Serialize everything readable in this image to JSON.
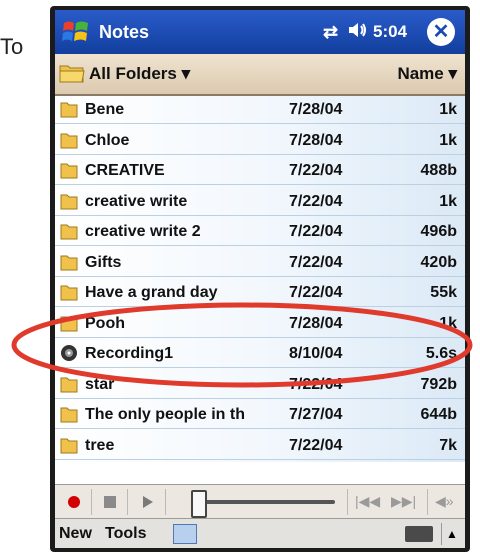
{
  "side_text": "To",
  "titlebar": {
    "app_title": "Notes",
    "clock": "5:04",
    "close_label": "✕",
    "sync_icon": "⇄",
    "volume_icon": "◀€"
  },
  "folderbar": {
    "folder_label": "All Folders ▾",
    "sort_label": "Name ▾"
  },
  "files": [
    {
      "name": "Bene",
      "date": "7/28/04",
      "size": "1k",
      "type": "folder"
    },
    {
      "name": "Chloe",
      "date": "7/28/04",
      "size": "1k",
      "type": "folder"
    },
    {
      "name": "CREATIVE",
      "date": "7/22/04",
      "size": "488b",
      "type": "folder"
    },
    {
      "name": "creative write",
      "date": "7/22/04",
      "size": "1k",
      "type": "folder"
    },
    {
      "name": "creative write 2",
      "date": "7/22/04",
      "size": "496b",
      "type": "folder"
    },
    {
      "name": "Gifts",
      "date": "7/22/04",
      "size": "420b",
      "type": "folder"
    },
    {
      "name": "Have a grand day",
      "date": "7/22/04",
      "size": "55k",
      "type": "folder"
    },
    {
      "name": "Pooh",
      "date": "7/28/04",
      "size": "1k",
      "type": "folder"
    },
    {
      "name": "Recording1",
      "date": "8/10/04",
      "size": "5.6s",
      "type": "recording"
    },
    {
      "name": "star",
      "date": "7/22/04",
      "size": "792b",
      "type": "folder"
    },
    {
      "name": "The only people in th",
      "date": "7/27/04",
      "size": "644b",
      "type": "folder"
    },
    {
      "name": "tree",
      "date": "7/22/04",
      "size": "7k",
      "type": "folder"
    }
  ],
  "toolbar": {
    "prev_label": "|◀◀",
    "next_label": "▶▶|",
    "speaker_label": "◀»"
  },
  "menubar": {
    "new_label": "New",
    "tools_label": "Tools",
    "up_arrow": "▲"
  },
  "colors": {
    "titlebar": "#1a4bb5",
    "highlight_ellipse": "#e03a2c",
    "record_button": "#d20000"
  }
}
